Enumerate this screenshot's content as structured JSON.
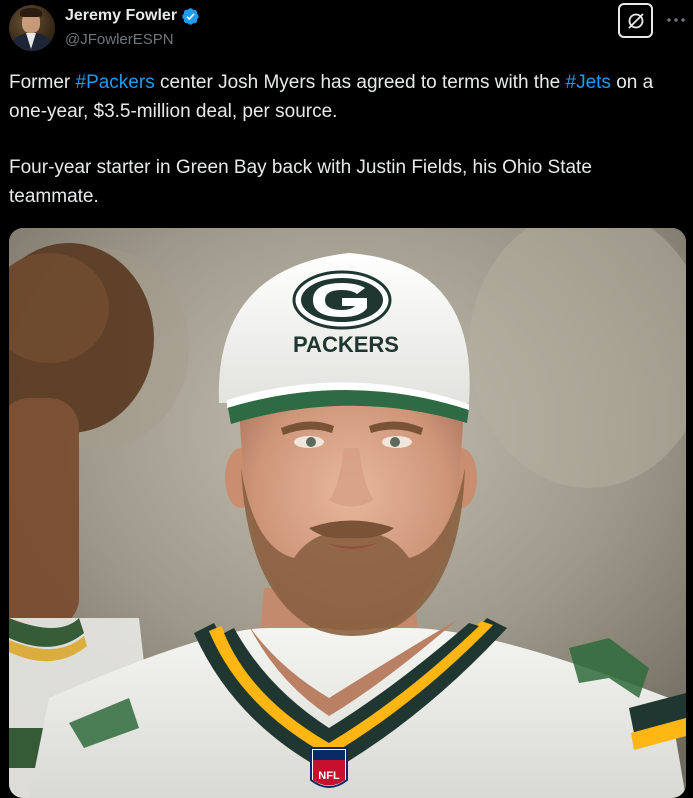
{
  "author": {
    "display_name": "Jeremy Fowler",
    "handle": "@JFowlerESPN",
    "verified": true,
    "verified_color": "#1d9bf0"
  },
  "actions": {
    "grok_icon": "grok-icon",
    "more_icon": "more-icon"
  },
  "tweet": {
    "para1_before": "Former ",
    "hashtag1": "#Packers",
    "para1_middle": " center Josh Myers has agreed to terms with the ",
    "hashtag2": "#Jets",
    "para1_after": " on a one-year, $3.5-million deal, per source.",
    "para2": "Four-year starter in Green Bay back with Justin Fields, his Ohio State teammate."
  },
  "media": {
    "cap_text": "PACKERS",
    "badge_text": "NFL"
  },
  "colors": {
    "background": "#000000",
    "text": "#e7e9ea",
    "secondary_text": "#71767b",
    "link": "#1d9bf0",
    "packers_green": "#203731",
    "packers_gold": "#ffb612"
  }
}
